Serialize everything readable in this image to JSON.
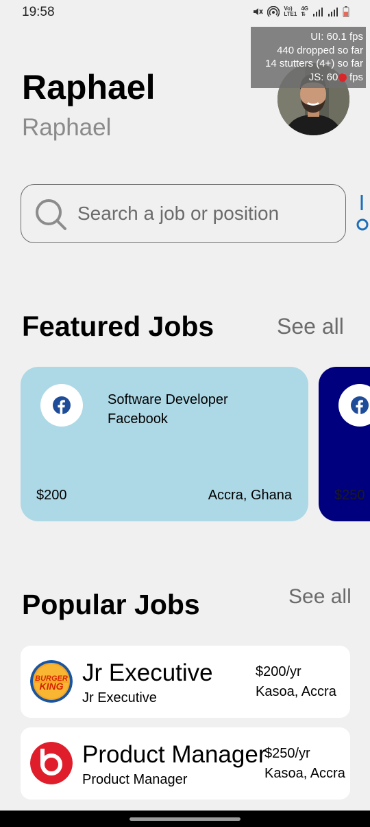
{
  "status_bar": {
    "time": "19:58",
    "net_label_top": "Vo)",
    "net_label_bottom": "LTE1",
    "net_type": "4G"
  },
  "fps_overlay": {
    "line1": "UI: 60.1 fps",
    "line2": "440 dropped so far",
    "line3": "14 stutters (4+) so far",
    "line4": "JS: 60.1 fps"
  },
  "header": {
    "greeting": "Raphael",
    "subtitle": "Raphael"
  },
  "search": {
    "placeholder": "Search a job or position",
    "value": ""
  },
  "featured": {
    "title": "Featured Jobs",
    "see_all": "See all",
    "cards": [
      {
        "role": "Software Developer",
        "company": "Facebook",
        "salary": "$200",
        "location": "Accra, Ghana",
        "bg": "#add8e6"
      },
      {
        "salary": "$250",
        "bg": "#00007e"
      }
    ]
  },
  "popular": {
    "title": "Popular Jobs",
    "see_all": "See all",
    "items": [
      {
        "title": "Jr Executive",
        "subtitle": "Jr Executive",
        "salary": "$200/yr",
        "location": "Kasoa, Accra",
        "logo_text_top": "BURGER",
        "logo_text_bottom": "KING"
      },
      {
        "title": "Product Manager",
        "subtitle": "Product Manager",
        "salary": "$250/yr",
        "location": "Kasoa, Accra"
      }
    ]
  },
  "colors": {
    "background": "#f0f0f0",
    "featured_card_1": "#add8e6",
    "featured_card_2": "#00007e",
    "facebook_blue": "#1f4c99",
    "beats_red": "#e01e2b"
  }
}
